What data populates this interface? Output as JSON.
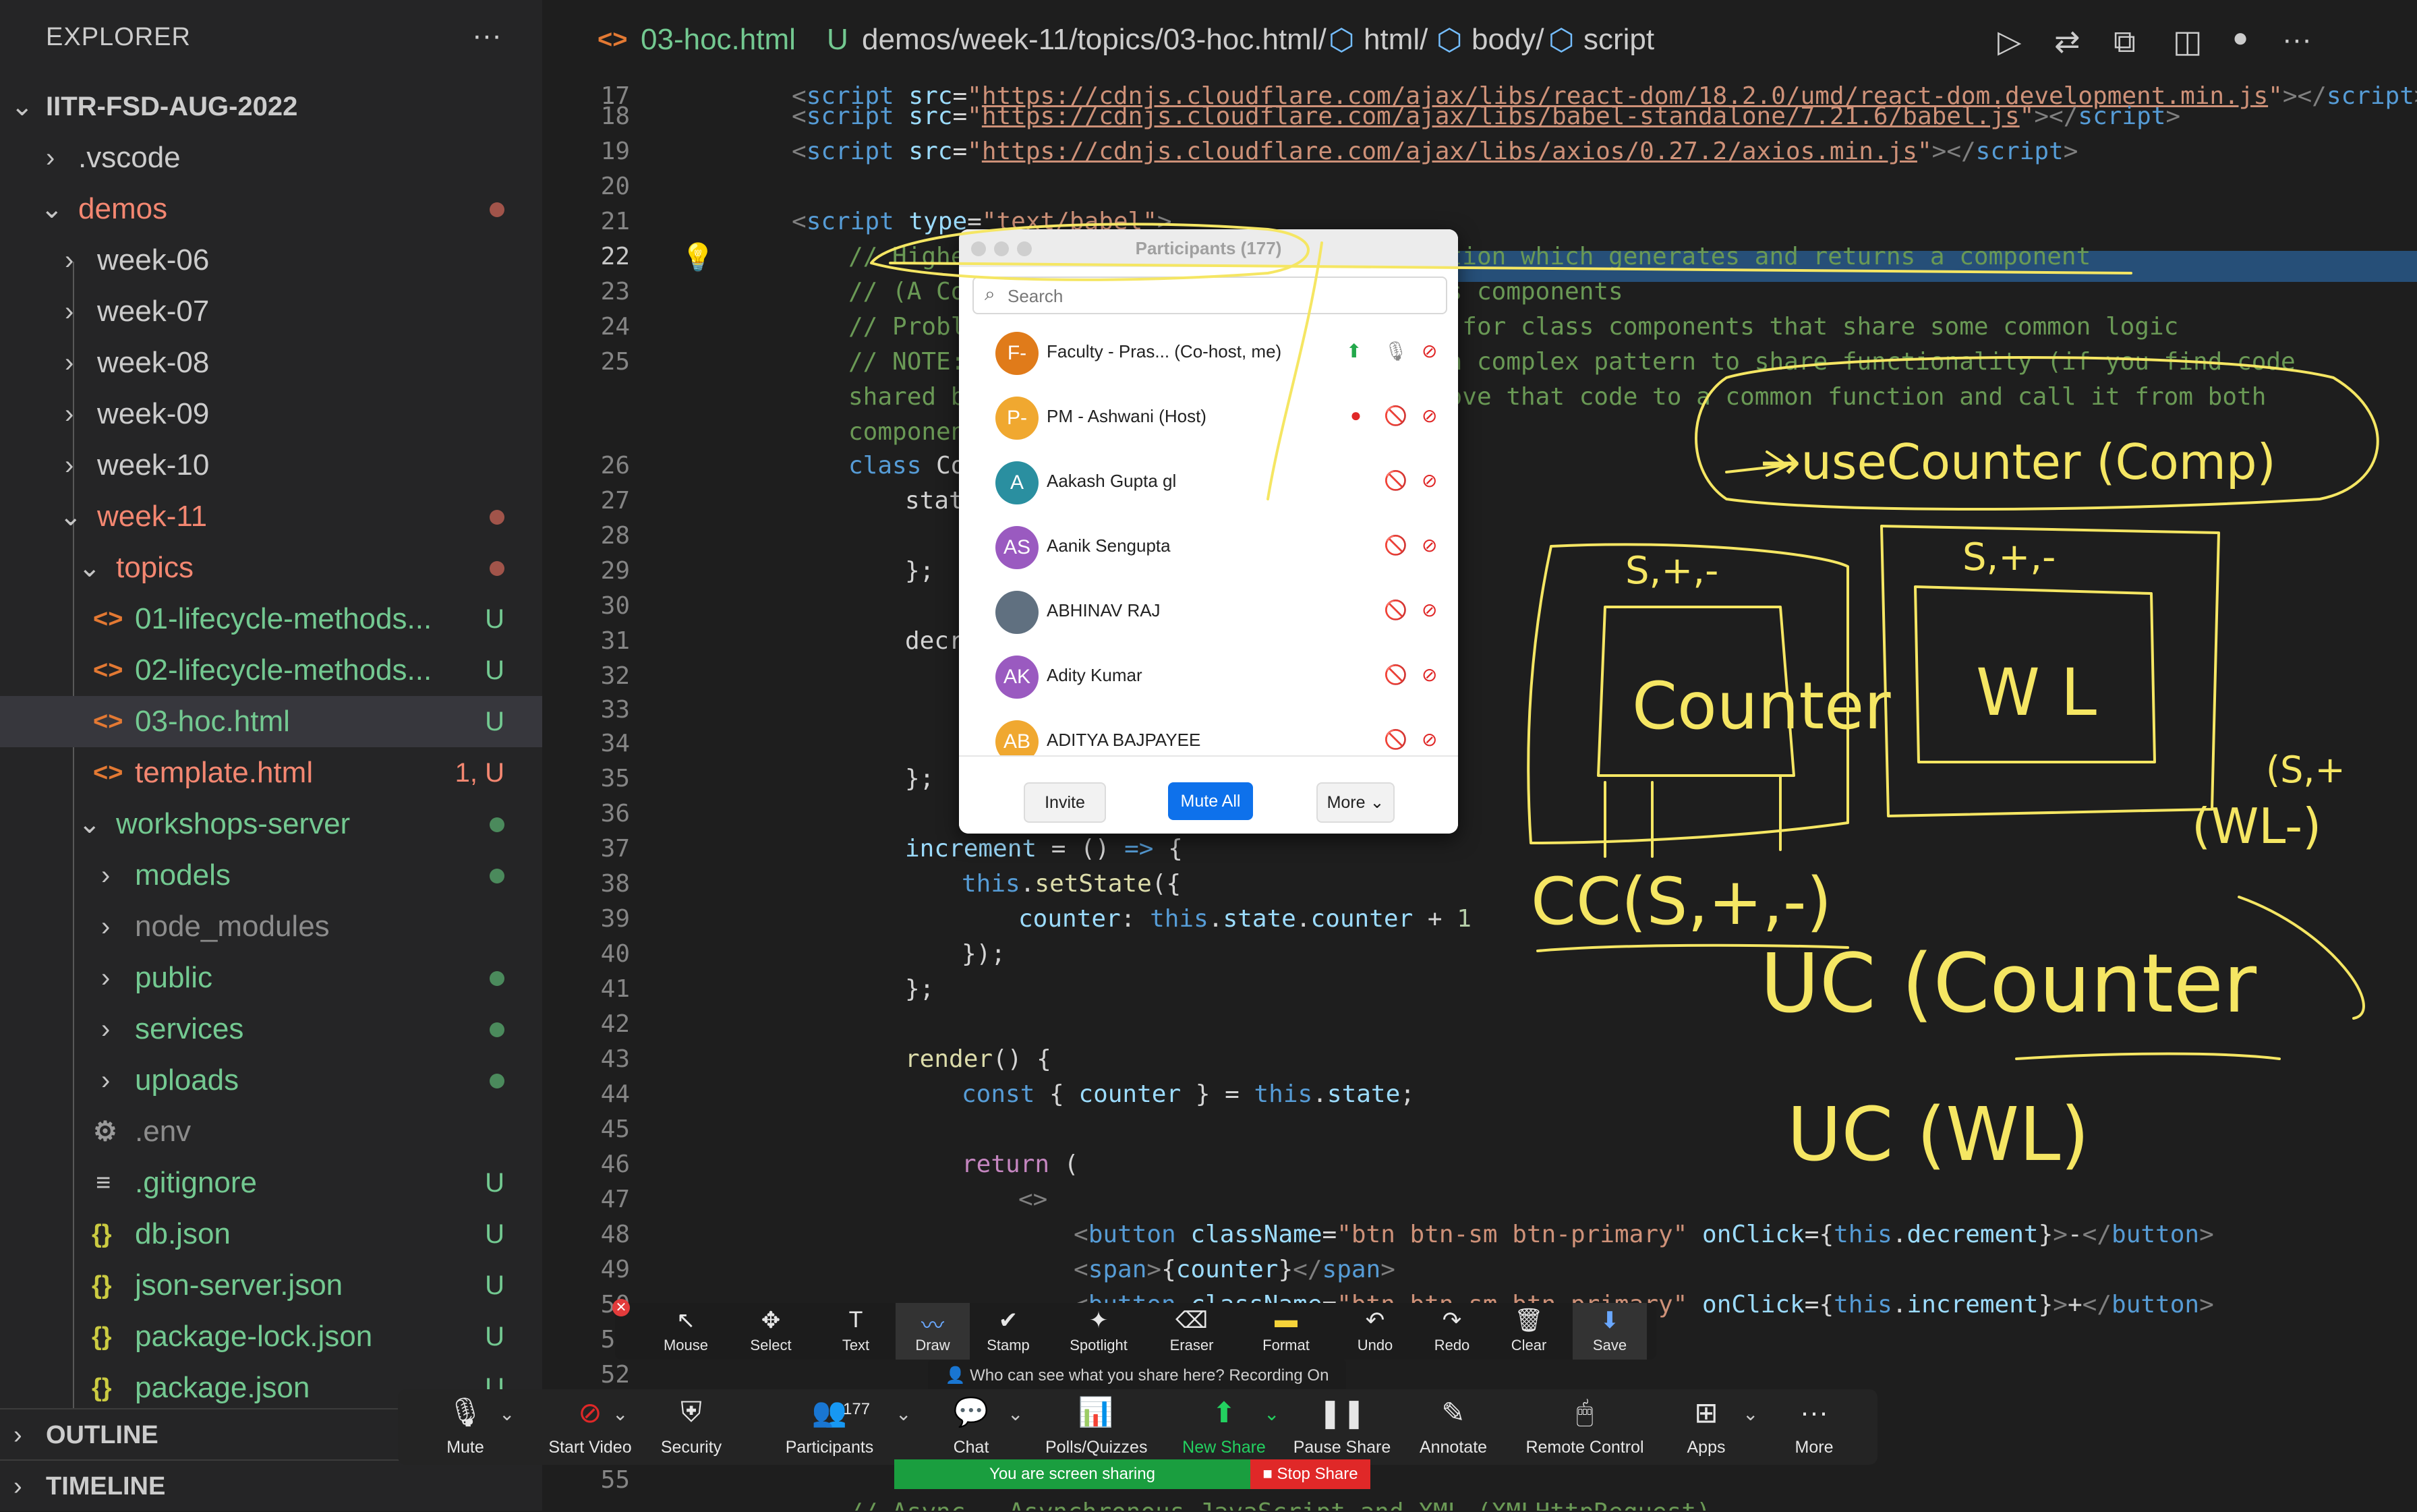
{
  "explorer": {
    "title": "EXPLORER",
    "more": "···",
    "root": "IITR-FSD-AUG-2022",
    "items": [
      {
        "label": ".vscode",
        "badge": ""
      },
      {
        "label": "demos",
        "badge": ""
      },
      {
        "label": "week-06",
        "badge": ""
      },
      {
        "label": "week-07",
        "badge": ""
      },
      {
        "label": "week-08",
        "badge": ""
      },
      {
        "label": "week-09",
        "badge": ""
      },
      {
        "label": "week-10",
        "badge": ""
      },
      {
        "label": "week-11",
        "badge": ""
      },
      {
        "label": "topics",
        "badge": ""
      },
      {
        "label": "01-lifecycle-methods...",
        "badge": "U"
      },
      {
        "label": "02-lifecycle-methods...",
        "badge": "U"
      },
      {
        "label": "03-hoc.html",
        "badge": "U"
      },
      {
        "label": "template.html",
        "badge": "1, U"
      },
      {
        "label": "workshops-server",
        "badge": ""
      },
      {
        "label": "models",
        "badge": ""
      },
      {
        "label": "node_modules",
        "badge": ""
      },
      {
        "label": "public",
        "badge": ""
      },
      {
        "label": "services",
        "badge": ""
      },
      {
        "label": "uploads",
        "badge": ""
      },
      {
        "label": ".env",
        "badge": ""
      },
      {
        "label": ".gitignore",
        "badge": "U"
      },
      {
        "label": "db.json",
        "badge": "U"
      },
      {
        "label": "json-server.json",
        "badge": "U"
      },
      {
        "label": "package-lock.json",
        "badge": "U"
      },
      {
        "label": "package.json",
        "badge": "U"
      }
    ],
    "outline": "OUTLINE",
    "timeline": "TIMELINE"
  },
  "tab": {
    "filename": "03-hoc.html",
    "status": "U",
    "breadcrumb": "demos/week-11/topics/03-hoc.html/",
    "crumb_html": "html/",
    "crumb_body": "body/",
    "crumb_script": "script"
  },
  "editor": {
    "line_numbers": [
      "17",
      "18",
      "19",
      "20",
      "21",
      "22",
      "23",
      "24",
      "25",
      "",
      "",
      "26",
      "27",
      "28",
      "29",
      "30",
      "31",
      "32",
      "33",
      "34",
      "35",
      "36",
      "37",
      "38",
      "39",
      "40",
      "41",
      "42",
      "43",
      "44",
      "45",
      "46",
      "47",
      "48",
      "49",
      "50",
      "51",
      "52",
      "",
      "",
      "55"
    ]
  },
  "participants": {
    "title": "Participants (177)",
    "search_placeholder": "Search",
    "list": [
      {
        "initials": "F-",
        "name": "Faculty - Pras...  (Co-host, me)",
        "color": "#e07b1a"
      },
      {
        "initials": "P-",
        "name": "PM - Ashwani (Host)",
        "color": "#f0a830"
      },
      {
        "initials": "A",
        "name": "Aakash Gupta gl",
        "color": "#2a8fa0"
      },
      {
        "initials": "AS",
        "name": "Aanik Sengupta",
        "color": "#9a5ac0"
      },
      {
        "initials": "",
        "name": "ABHINAV RAJ",
        "color": "#607080"
      },
      {
        "initials": "AK",
        "name": "Adity Kumar",
        "color": "#9a5ac0"
      },
      {
        "initials": "AB",
        "name": "ADITYA BAJPAYEE",
        "color": "#f0a830"
      }
    ],
    "invite": "Invite",
    "mute_all": "Mute All",
    "more": "More"
  },
  "annotate_toolbar": {
    "tools": [
      "Mouse",
      "Select",
      "Text",
      "Draw",
      "Stamp",
      "Spotlight",
      "Eraser",
      "Format",
      "Undo",
      "Redo",
      "Clear",
      "Save"
    ],
    "tooltip": "Who can see what you share here? Recording On"
  },
  "meeting_bar": {
    "mute": "Mute",
    "start_video": "Start Video",
    "security": "Security",
    "participants": "Participants",
    "participants_count": "177",
    "chat": "Chat",
    "polls": "Polls/Quizzes",
    "new_share": "New Share",
    "pause_share": "Pause Share",
    "annotate": "Annotate",
    "remote_control": "Remote Control",
    "apps": "Apps",
    "more": "More",
    "sharing_status": "You are screen sharing",
    "stop_share": "Stop Share"
  },
  "colors": {
    "ink": "#f5e663",
    "zoom_blue": "#0e71eb",
    "share_green": "#1a9e3f",
    "stop_red": "#e02828"
  }
}
